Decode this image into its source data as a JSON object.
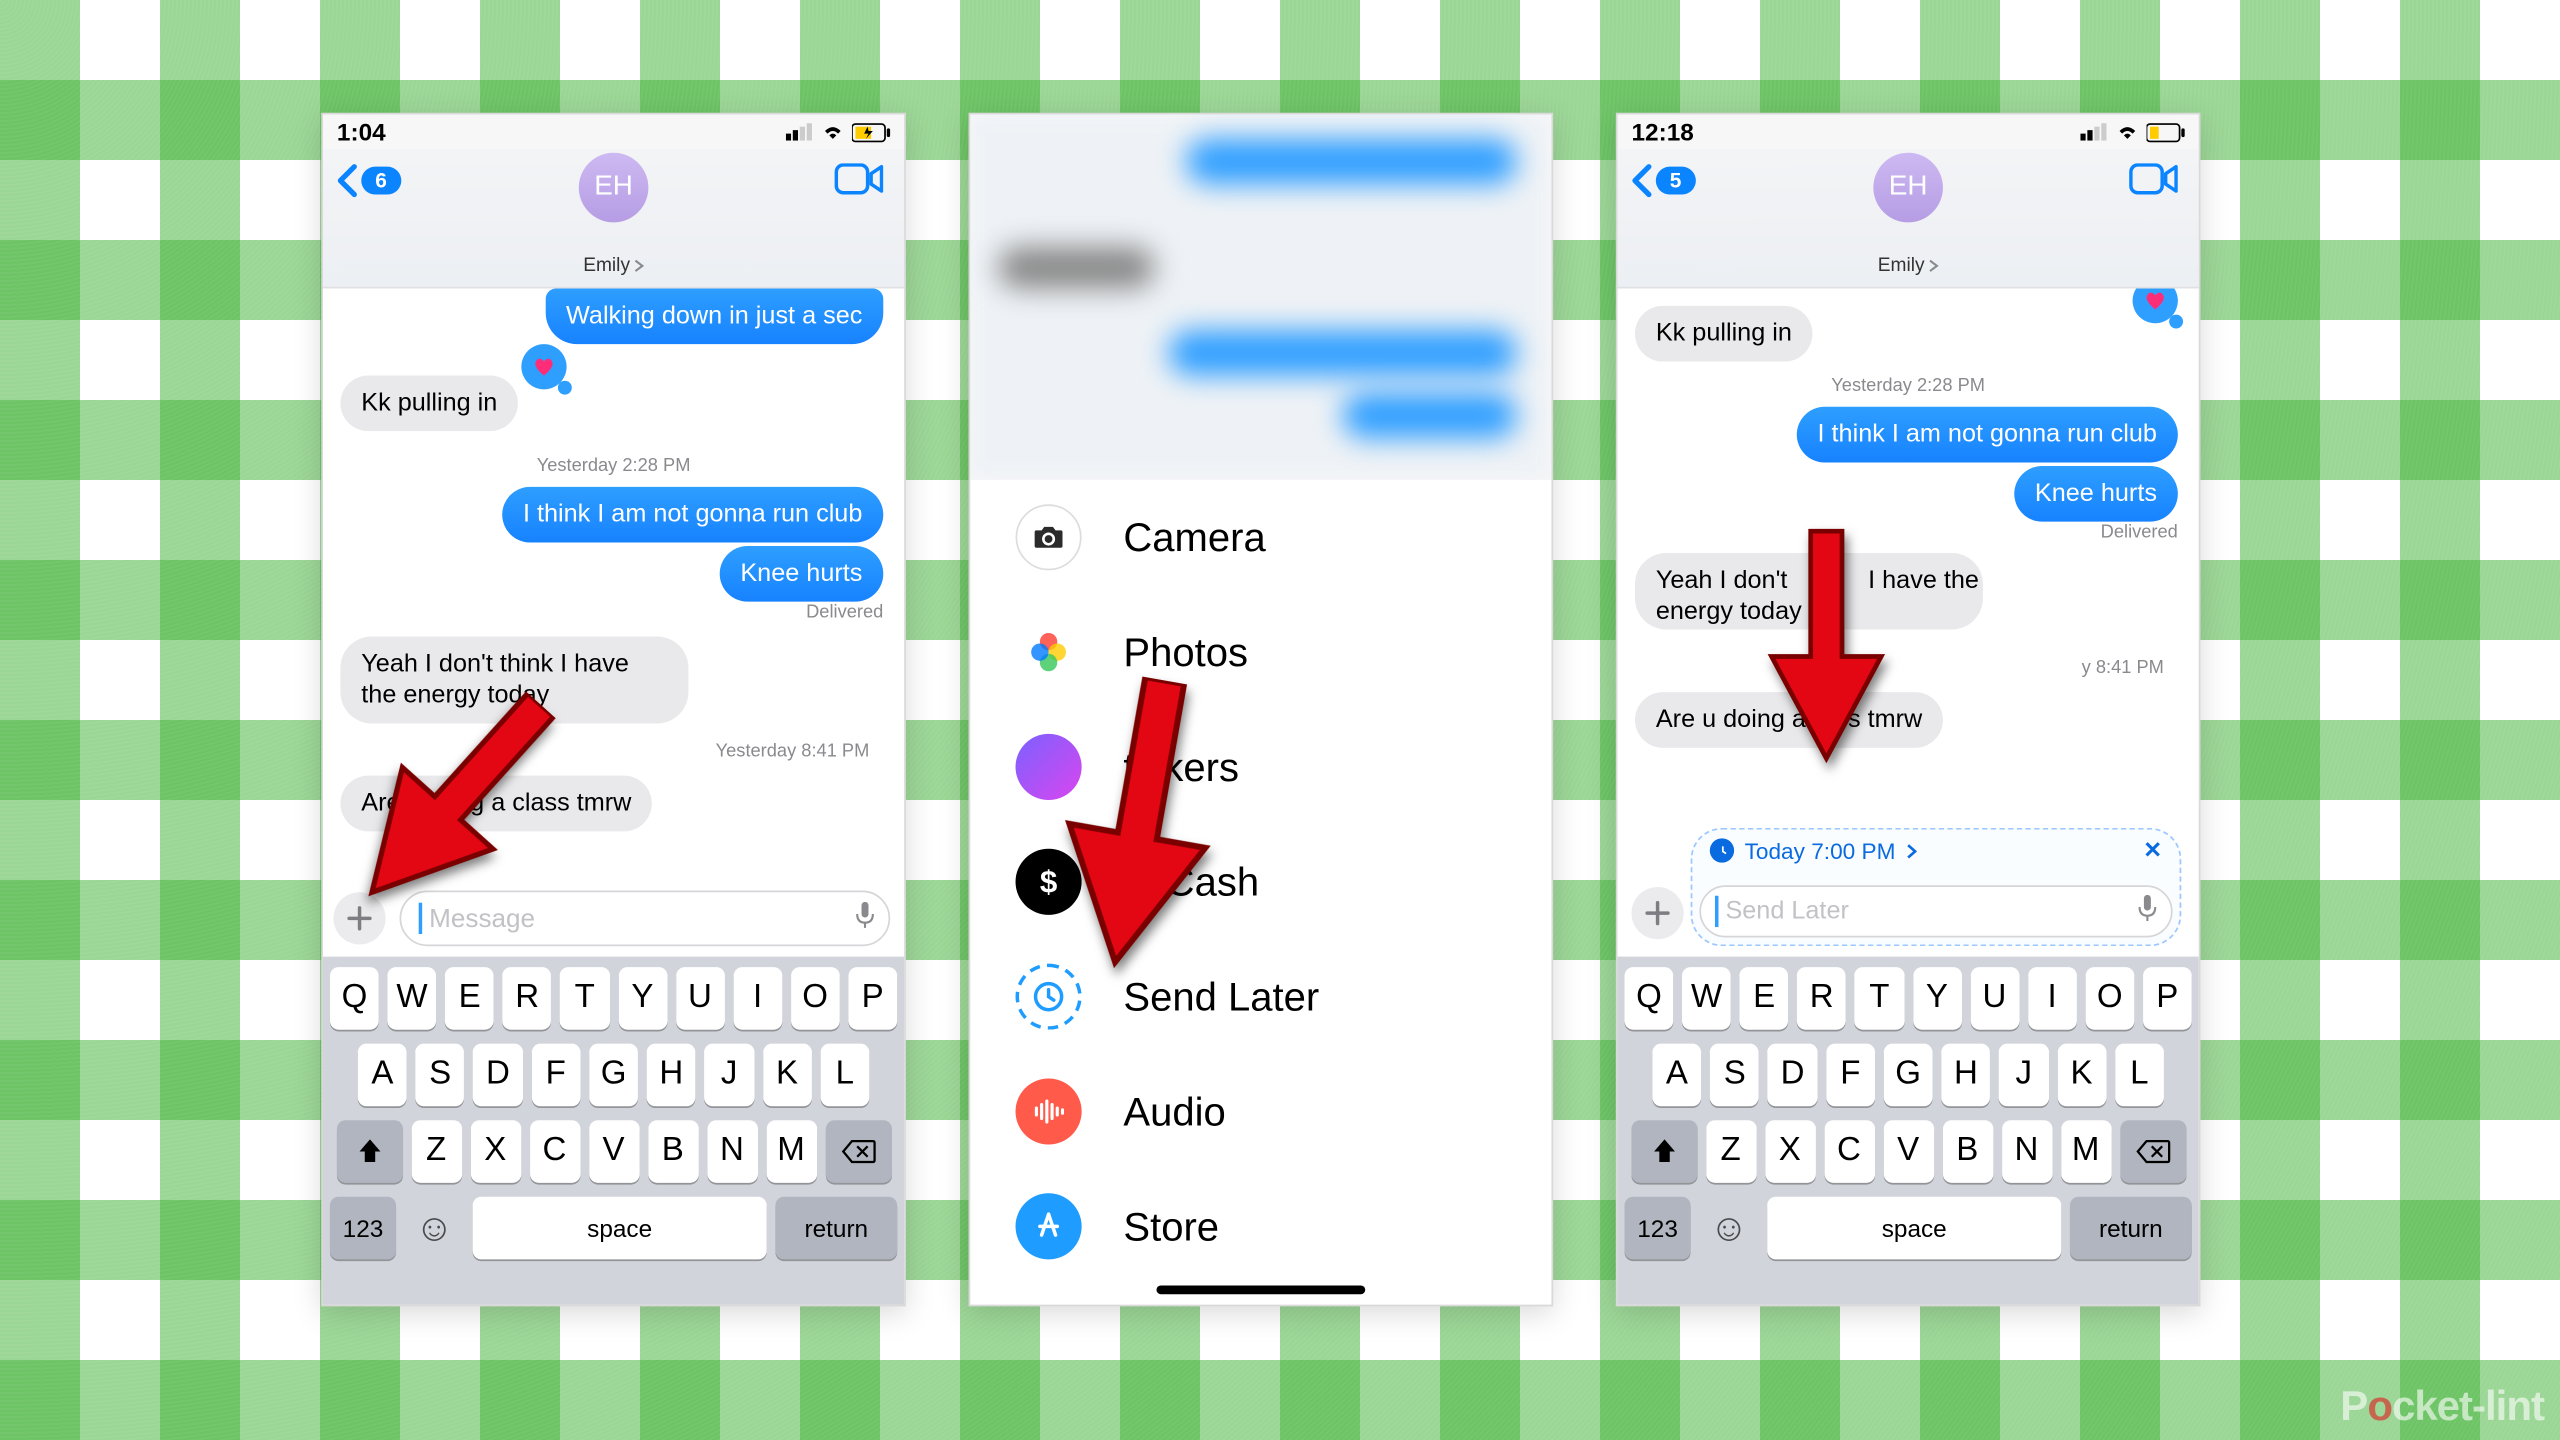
{
  "watermark": {
    "part1": "P",
    "accent": "o",
    "part2": "cket-lint"
  },
  "statusA": {
    "time": "1:04"
  },
  "statusC": {
    "time": "12:18"
  },
  "contact": {
    "initials": "EH",
    "name": "Emily"
  },
  "backA": "6",
  "backC": "5",
  "threadA": {
    "out1": "Walking down in just a sec",
    "in1": "Kk pulling in",
    "ts1": "Yesterday 2:28 PM",
    "out2": "I think I am not gonna run club",
    "out3": "Knee hurts",
    "delivered": "Delivered",
    "in2": "Yeah I don't think I have the energy today",
    "ts2": "Yesterday 8:41 PM",
    "in3_a": "Are",
    "in3_b": "g a class tmrw"
  },
  "threadC": {
    "in1": "Kk pulling in",
    "ts1": "Yesterday 2:28 PM",
    "out1": "I think I am not gonna run club",
    "out2": "Knee hurts",
    "delivered": "Delivered",
    "in2_a": "Yeah I don't",
    "in2_b": "I have the",
    "in2_c": "energy today",
    "ts2_part": "y 8:41 PM",
    "in3_a": "Are u doing a",
    "in3_b": "s tmrw"
  },
  "inputA": {
    "placeholder": "Message"
  },
  "inputC": {
    "placeholder": "Send Later"
  },
  "schedule": {
    "label": "Today 7:00 PM",
    "close": "✕"
  },
  "menu": {
    "camera": "Camera",
    "photos": "Photos",
    "stickers": "tickers",
    "cash": "le Cash",
    "sendlater": "Send Later",
    "audio": "Audio",
    "store": "Store"
  },
  "keys": {
    "r1": [
      "Q",
      "W",
      "E",
      "R",
      "T",
      "Y",
      "U",
      "I",
      "O",
      "P"
    ],
    "r2": [
      "A",
      "S",
      "D",
      "F",
      "G",
      "H",
      "J",
      "K",
      "L"
    ],
    "r3": [
      "Z",
      "X",
      "C",
      "V",
      "B",
      "N",
      "M"
    ],
    "k123": "123",
    "space": "space",
    "ret": "return"
  }
}
